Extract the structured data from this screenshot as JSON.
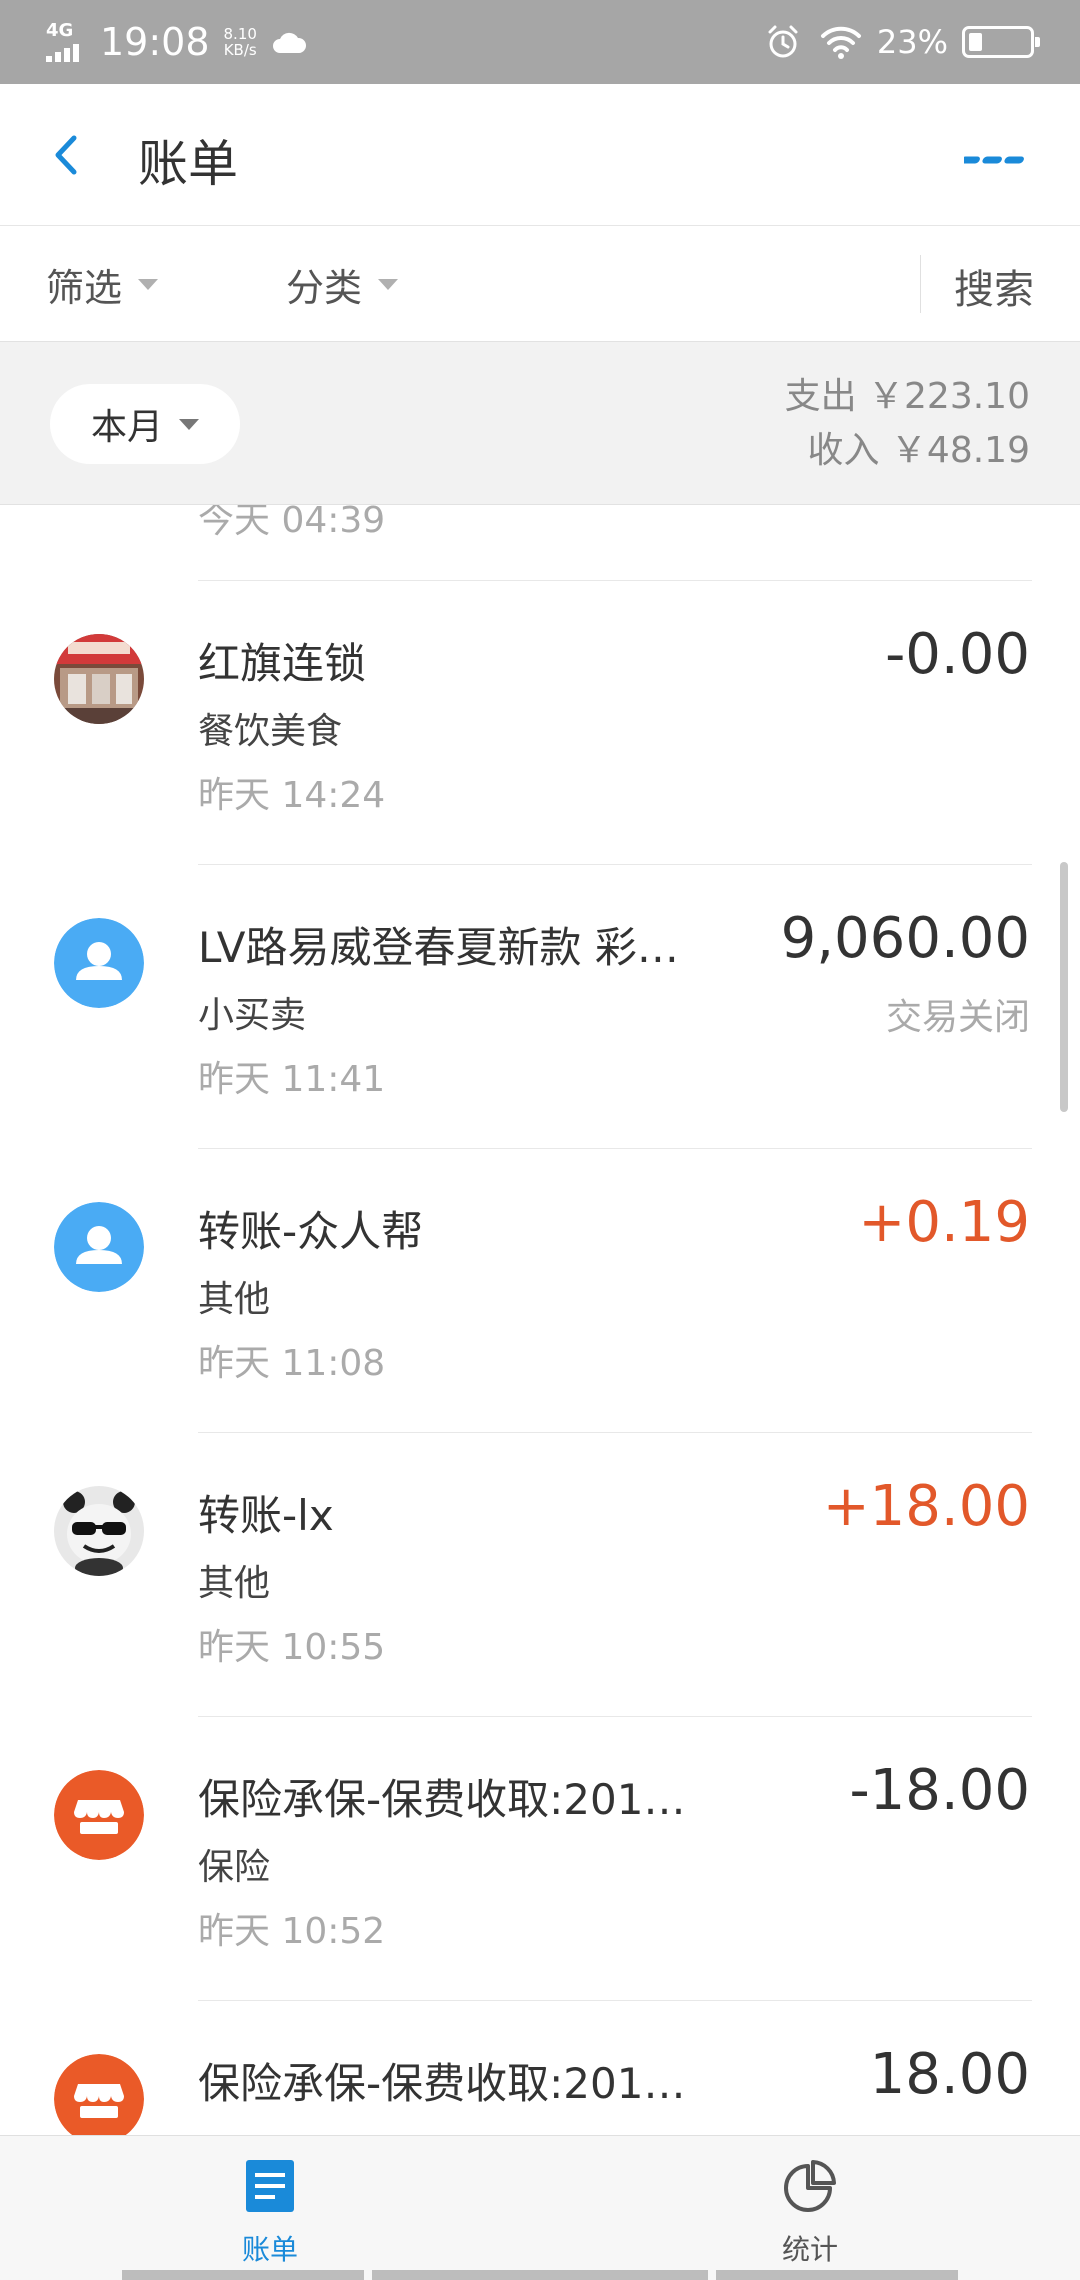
{
  "status_bar": {
    "network": "4G",
    "time": "19:08",
    "speed_value": "8.10",
    "speed_unit": "KB/s",
    "battery": "23%",
    "battery_level": 0.23
  },
  "header": {
    "title": "账单"
  },
  "filters": {
    "filter_label": "筛选",
    "category_label": "分类",
    "search_label": "搜索"
  },
  "summary": {
    "period": "本月",
    "expense": "支出 ￥223.10",
    "income": "收入 ￥48.19"
  },
  "transactions": {
    "partial_top_time": "今天 04:39",
    "items": [
      {
        "title": "红旗连锁",
        "category": "餐饮美食",
        "time": "昨天  14:24",
        "amount": "-0.00",
        "status": "",
        "avatar": "store-photo"
      },
      {
        "title": "LV路易威登春夏新款 彩…",
        "category": "小买卖",
        "time": "昨天  11:41",
        "amount": "9,060.00",
        "status": "交易关闭",
        "avatar": "user-icon"
      },
      {
        "title": "转账-众人帮",
        "category": "其他",
        "time": "昨天  11:08",
        "amount": "+0.19",
        "status": "",
        "avatar": "user-icon"
      },
      {
        "title": "转账-lx",
        "category": "其他",
        "time": "昨天  10:55",
        "amount": "+18.00",
        "status": "",
        "avatar": "panda-photo"
      },
      {
        "title": "保险承保-保费收取:201…",
        "category": "保险",
        "time": "昨天  10:52",
        "amount": "-18.00",
        "status": "",
        "avatar": "shop-icon"
      },
      {
        "title": "保险承保-保费收取:201…",
        "category": "",
        "time": "",
        "amount": "18.00",
        "status": "",
        "avatar": "shop-icon"
      }
    ]
  },
  "tabs": {
    "bill": "账单",
    "stats": "统计"
  },
  "colors": {
    "accent_blue": "#1a8ad9",
    "income_orange": "#e2582a",
    "avatar_blue": "#4aabf4",
    "avatar_orange": "#ea5a28"
  }
}
